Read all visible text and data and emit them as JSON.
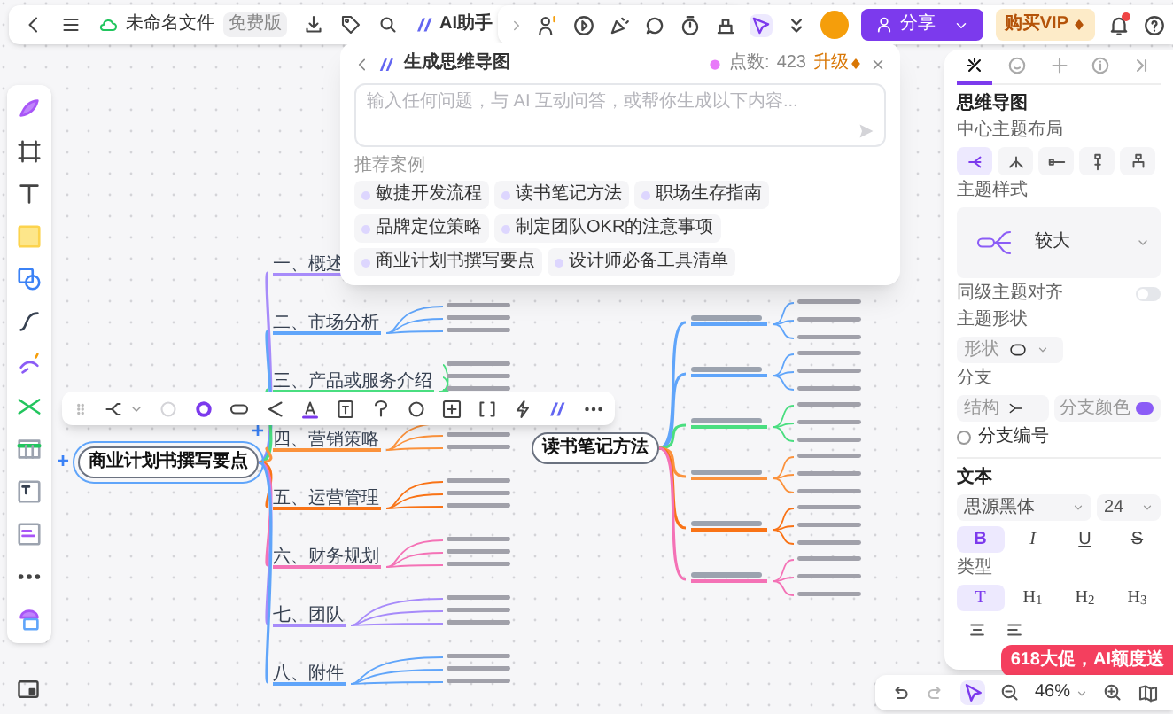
{
  "top_bar": {
    "file_name": "未命名文件",
    "plan_badge": "免费版",
    "ai_button": "AI助手"
  },
  "top_right": {
    "share_button": "分享",
    "vip_button": "购买VIP",
    "notification_dot": true
  },
  "ai_panel": {
    "title": "生成思维导图",
    "points_label": "点数:",
    "points": "423",
    "upgrade": "升级",
    "placeholder": "输入任何问题，与 AI 互动问答，或帮你生成以下内容...",
    "section_title": "推荐案例",
    "suggestions": [
      "敏捷开发流程",
      "读书笔记方法",
      "职场生存指南",
      "品牌定位策略",
      "制定团队OKR的注意事项",
      "商业计划书撰写要点",
      "设计师必备工具清单"
    ]
  },
  "mind_maps": [
    {
      "center": "商业计划书撰写要点",
      "selected": true,
      "add_buttons": [
        "+",
        "+"
      ],
      "branches": [
        {
          "label": "一、概述",
          "color": "#a78bfa"
        },
        {
          "label": "二、市场分析",
          "color": "#60a5fa"
        },
        {
          "label": "三、产品或服务介绍",
          "color": "#4ade80"
        },
        {
          "label": "四、营销策略",
          "color": "#fb923c"
        },
        {
          "label": "五、运营管理",
          "color": "#f97316"
        },
        {
          "label": "六、财务规划",
          "color": "#f472b6"
        },
        {
          "label": "七、团队",
          "color": "#a78bfa"
        },
        {
          "label": "八、附件",
          "color": "#60a5fa"
        }
      ]
    },
    {
      "center": "读书笔记方法",
      "selected": false,
      "branches": [
        {
          "color": "#60a5fa"
        },
        {
          "color": "#60a5fa"
        },
        {
          "color": "#4ade80"
        },
        {
          "color": "#fb923c"
        },
        {
          "color": "#f97316"
        },
        {
          "color": "#f472b6"
        }
      ]
    }
  ],
  "right_panel": {
    "tabs": [
      {
        "selected": true
      },
      {
        "selected": false
      },
      {
        "selected": false
      },
      {
        "selected": false
      },
      {
        "selected": false
      }
    ],
    "section_title": "思维导图",
    "layout_label": "中心主题布局",
    "layouts": [
      {
        "selected": true
      },
      {
        "selected": false
      },
      {
        "selected": false
      },
      {
        "selected": false
      },
      {
        "selected": false
      }
    ],
    "style_label": "主题样式",
    "style_value": "较大",
    "align_label": "同级主题对齐",
    "align_on": false,
    "shape_label": "主题形状",
    "shape_field": "形状",
    "branch_label": "分支",
    "structure_field": "结构",
    "branch_color": {
      "label": "分支颜色",
      "color": "#8b5cf6"
    },
    "numbering_label": "分支编号",
    "numbering_checked": false,
    "text_label": "文本",
    "font": "思源黑体",
    "size": "24",
    "text_styles": [
      {
        "kind": "bold",
        "label": "B",
        "selected": true
      },
      {
        "kind": "italic",
        "label": "I",
        "selected": false
      },
      {
        "kind": "underline",
        "label": "U",
        "selected": false
      },
      {
        "kind": "strike",
        "label": "S",
        "selected": false
      }
    ],
    "type_label": "类型",
    "types": [
      {
        "label": "T",
        "selected": true
      },
      {
        "label": "H$_{1}$",
        "selected": false
      },
      {
        "label": "H$_{2}$",
        "selected": false
      },
      {
        "label": "H$_{3}$",
        "selected": false
      }
    ],
    "promo": "618大促，AI额度送"
  },
  "bottom_bar": {
    "zoom": "46%",
    "pointer_selected": true
  }
}
